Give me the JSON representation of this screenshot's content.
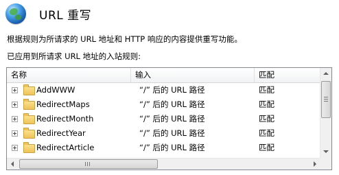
{
  "header": {
    "title": "URL 重写",
    "icon": "globe-icon"
  },
  "description": {
    "line1": "根据规则为所请求的 URL 地址和 HTTP 响应的内容提供重写功能。",
    "line2": "已应用到所请求 URL 地址的入站规则:"
  },
  "grid": {
    "columns": [
      "名称",
      "输入",
      "匹配"
    ],
    "rows": [
      {
        "name": "AddWWW",
        "input": "“/” 后的 URL 路径",
        "match": "匹配"
      },
      {
        "name": "RedirectMaps",
        "input": "“/” 后的 URL 路径",
        "match": "匹配"
      },
      {
        "name": "RedirectMonth",
        "input": "“/” 后的 URL 路径",
        "match": "匹配"
      },
      {
        "name": "RedirectYear",
        "input": "“/” 后的 URL 路径",
        "match": "匹配"
      },
      {
        "name": "RedirectArticle",
        "input": "“/” 后的 URL 路径",
        "match": "匹配"
      }
    ]
  },
  "icons": {
    "expander": "plus-icon",
    "folder": "folder-icon"
  }
}
